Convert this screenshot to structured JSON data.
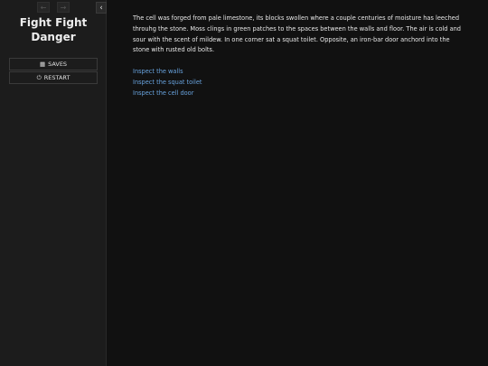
{
  "colors": {
    "background": "#111111",
    "sidebar": "#1c1c1c",
    "link": "#68a3de",
    "text": "#e8e8e8"
  },
  "sidebar": {
    "title": "Fight Fight Danger",
    "history": {
      "back_icon": "arrow-left-icon",
      "forward_icon": "arrow-right-icon"
    },
    "stow_icon": "chevron-left-icon",
    "menu": [
      {
        "label": "SAVES",
        "icon": "save-icon"
      },
      {
        "label": "RESTART",
        "icon": "power-icon"
      }
    ]
  },
  "passage": {
    "text": "The cell was forged from pale limestone, its blocks swollen where a couple centuries of moisture has leeched throuhg the stone. Moss clings in green patches to the spaces between the walls and floor. The air is cold and sour with the scent of mildew. In one corner sat a squat toilet. Opposite, an iron-bar door anchord into the stone with rusted old bolts.",
    "links": [
      "Inspect the walls",
      "Inspect the squat toilet",
      "Inspect the cell door"
    ]
  }
}
